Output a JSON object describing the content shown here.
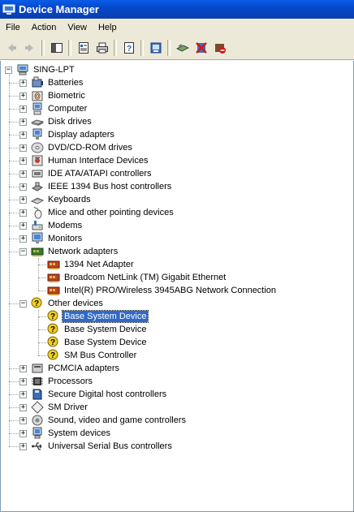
{
  "window": {
    "title": "Device Manager"
  },
  "menu": [
    "File",
    "Action",
    "View",
    "Help"
  ],
  "toolbar": {
    "buttons": [
      "back-icon",
      "forward-icon",
      "show-hide-tree-icon",
      "properties-icon",
      "print-icon",
      "help-icon",
      "update-driver-icon",
      "scan-hardware-icon",
      "uninstall-icon",
      "disable-icon"
    ]
  },
  "tree": {
    "root": "SING-LPT",
    "categories": [
      {
        "label": "Batteries",
        "icon": "battery-icon"
      },
      {
        "label": "Biometric",
        "icon": "biometric-icon"
      },
      {
        "label": "Computer",
        "icon": "computer-icon"
      },
      {
        "label": "Disk drives",
        "icon": "disk-drive-icon"
      },
      {
        "label": "Display adapters",
        "icon": "display-adapter-icon"
      },
      {
        "label": "DVD/CD-ROM drives",
        "icon": "dvd-drive-icon"
      },
      {
        "label": "Human Interface Devices",
        "icon": "hid-icon"
      },
      {
        "label": "IDE ATA/ATAPI controllers",
        "icon": "ide-controller-icon"
      },
      {
        "label": "IEEE 1394 Bus host controllers",
        "icon": "ieee1394-icon"
      },
      {
        "label": "Keyboards",
        "icon": "keyboard-icon"
      },
      {
        "label": "Mice and other pointing devices",
        "icon": "mouse-icon"
      },
      {
        "label": "Modems",
        "icon": "modem-icon"
      },
      {
        "label": "Monitors",
        "icon": "monitor-icon"
      },
      {
        "label": "Network adapters",
        "icon": "network-adapter-icon",
        "expanded": true,
        "children": [
          "1394 Net Adapter",
          "Broadcom NetLink (TM) Gigabit Ethernet",
          "Intel(R) PRO/Wireless 3945ABG Network Connection"
        ]
      },
      {
        "label": "Other devices",
        "icon": "unknown-device-icon",
        "expanded": true,
        "children": [
          "Base System Device",
          "Base System Device",
          "Base System Device",
          "SM Bus Controller"
        ]
      },
      {
        "label": "PCMCIA adapters",
        "icon": "pcmcia-icon"
      },
      {
        "label": "Processors",
        "icon": "processor-icon"
      },
      {
        "label": "Secure Digital host controllers",
        "icon": "sd-host-icon"
      },
      {
        "label": "SM Driver",
        "icon": "sm-driver-icon"
      },
      {
        "label": "Sound, video and game controllers",
        "icon": "sound-icon"
      },
      {
        "label": "System devices",
        "icon": "system-devices-icon"
      },
      {
        "label": "Universal Serial Bus controllers",
        "icon": "usb-icon"
      }
    ],
    "selected": "Base System Device"
  }
}
